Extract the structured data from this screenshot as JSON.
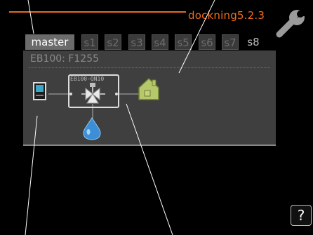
{
  "header": {
    "title": "dockning5.2.3",
    "settings_icon": "wrench-icon",
    "accent_color": "#e46a1e"
  },
  "tabs": [
    {
      "label": "master",
      "state": "active"
    },
    {
      "label": "s1",
      "state": "dim"
    },
    {
      "label": "s2",
      "state": "dim"
    },
    {
      "label": "s3",
      "state": "dim"
    },
    {
      "label": "s4",
      "state": "dim"
    },
    {
      "label": "s5",
      "state": "dim"
    },
    {
      "label": "s6",
      "state": "dim"
    },
    {
      "label": "s7",
      "state": "dim"
    },
    {
      "label": "s8",
      "state": "plain"
    }
  ],
  "panel": {
    "subtitle": "EB100: F1255",
    "valve_label": "EB100-QN10",
    "icons": [
      "heat-pump-icon",
      "valve-icon",
      "house-icon",
      "water-drop-icon"
    ]
  },
  "footer": {
    "help_label": "?"
  }
}
